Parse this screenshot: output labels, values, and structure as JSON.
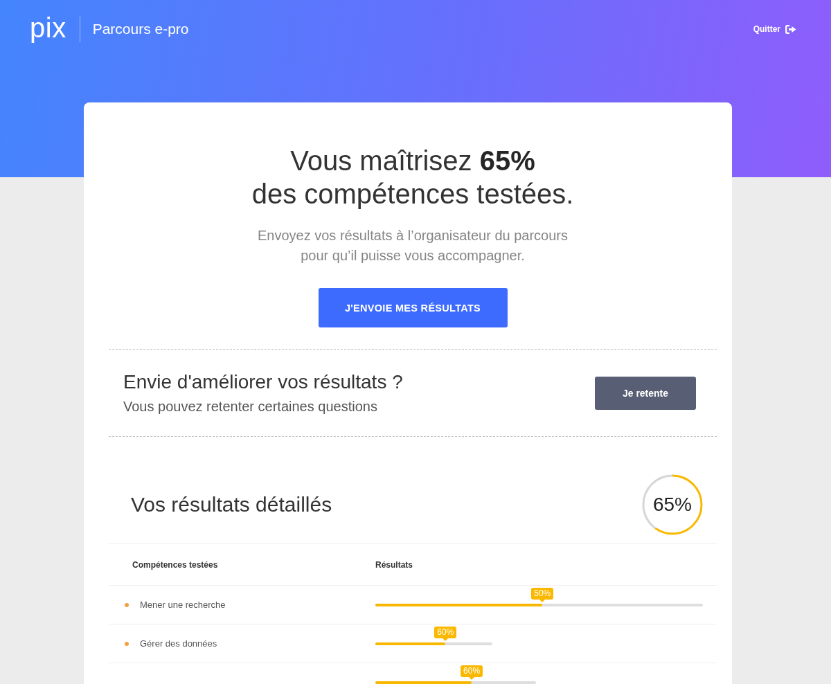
{
  "header": {
    "logo": "pix",
    "title": "Parcours e-pro",
    "quit_link": "Quitter"
  },
  "summary": {
    "title_lines": [
      "Vous maîtrisez **65%**",
      "des compétences testées."
    ],
    "message_lines": [
      "Envoyez vos résultats à l’organisateur du parcours",
      "pour qu’il puisse vous accompagner."
    ],
    "send_button": "J'ENVOIE MES RÉSULTATS"
  },
  "retry": {
    "heading": "Envie d'améliorer vos résultats ?",
    "text": "Vous pouvez retenter certaines questions",
    "button": "Je retente"
  },
  "details": {
    "title": "Vos résultats détaillés",
    "score": {
      "label": "65%",
      "level": 0.6
    },
    "table": {
      "columns": [
        "Compétences testées",
        "Résultats"
      ],
      "rows": [
        {
          "name": "Mener une recherche",
          "color": "#f1a141",
          "badge": "50%",
          "level": 0.51,
          "kind": "long"
        },
        {
          "name": "Gérer des données",
          "color": "#f1a141",
          "badge": "60%",
          "level": 0.6,
          "kind": "short"
        },
        {
          "badge": "60%",
          "level": 0.6,
          "kind": "medium"
        }
      ]
    }
  }
}
